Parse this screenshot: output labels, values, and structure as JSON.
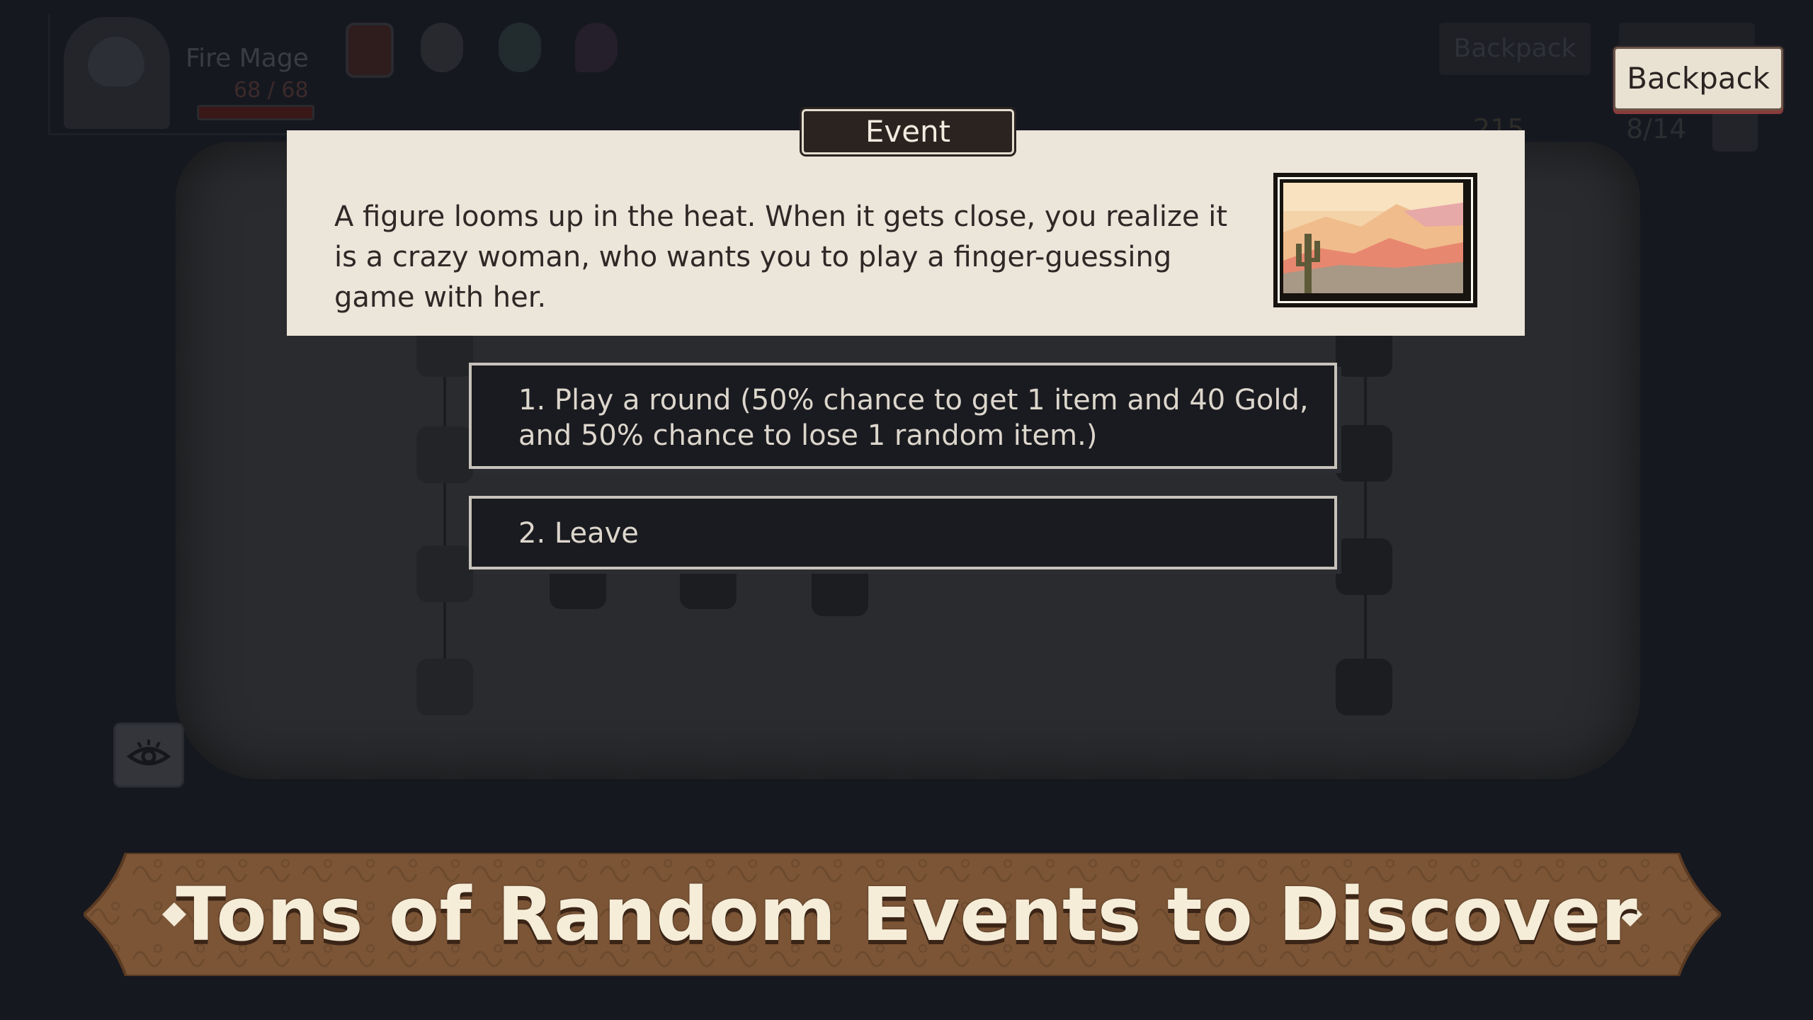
{
  "hero": {
    "name": "Fire Mage",
    "hp": "68 / 68"
  },
  "top_bar": {
    "backpack_label": "Backpack",
    "gold": "215",
    "bag_capacity": "8/14"
  },
  "event": {
    "tab_label": "Event",
    "description": "A figure looms up in the heat. When it gets close, you realize it is a crazy woman, who wants you to play a finger-guessing game with her.",
    "image_icon": "desert-cactus-scene",
    "choices": [
      {
        "label": "1. Play a round (50% chance to get 1 item and 40 Gold, and 50% chance to lose 1 random item.)"
      },
      {
        "label": "2. Leave"
      }
    ]
  },
  "banner": {
    "title": "Tons of Random Events to Discover"
  },
  "icons": {
    "view_map": "eye-icon"
  },
  "colors": {
    "panel": "#ebe5da",
    "choice_bg": "#1a1b20",
    "banner": "#7b5536",
    "hp_bar": "#6d1e1e"
  }
}
